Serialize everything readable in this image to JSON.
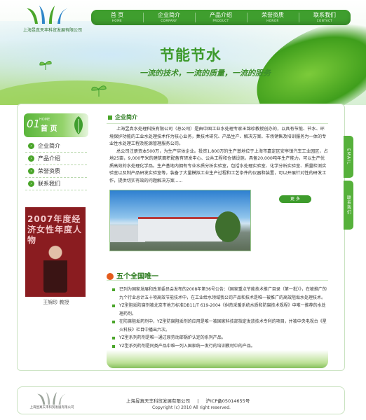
{
  "brand": {
    "company_name": "上海昱真天丰科贸发展有限公司"
  },
  "nav": [
    {
      "label": "首 页",
      "en": "HOME"
    },
    {
      "label": "企业简介",
      "en": "COMPANY"
    },
    {
      "label": "产品介绍",
      "en": "PRODUCT"
    },
    {
      "label": "荣誉资质",
      "en": "HONOR"
    },
    {
      "label": "联系我们",
      "en": "CONTACT"
    }
  ],
  "banner": {
    "slogan": "节能节水",
    "subslogan": "一流的技术，一流的质量，一流的服务"
  },
  "sidebar": {
    "head_num": "01",
    "head_en": "HOME",
    "head_title": "首 页",
    "items": [
      {
        "label": "企业简介"
      },
      {
        "label": "产品介绍"
      },
      {
        "label": "荣誉资质"
      },
      {
        "label": "联系我们"
      }
    ],
    "photo_text": "2007年度经济女性年度人物",
    "photo_caption": "王锦珍 教授"
  },
  "right_tabs": {
    "email": "EMAIL",
    "contact": "联系我们"
  },
  "intro_section": {
    "title": "企业简介",
    "paragraphs": [
      "上海昱真水处理科技有限公司（总公司）是由中国工业水处理专家王锦珍教授创办的，以具有节能、节水、环境保护功能的工业水处理技术作为核心业务，集技术研究、产品生产、解决方案、市场销售及培训服务为一体的专业性水处理工程及能源管理服务公司。",
      "总公司注册资本500万，为生产实体企业。投资1,800万的生产基地位于上海市嘉定区安亭镇汽车工业园区，占地25亩，9,000平米的建筑面积配备有研发中心、公共工程和仓储设施，具备20,000吨年生产能力，可以生产优质高效的水处理化学品。生产基地内拥有专业水质分析实验室，包括水处理实验室、化学分析实验室、质量检测实验室以及制产品研发实验室等，装备了大量模拟工业生产过程和工艺条件的仪器和装置，可以开展针对性的研发工作，提供切实有效的问题解决方案......"
    ],
    "more": "更 多"
  },
  "unique_section": {
    "title": "五个全国唯一",
    "bullets": [
      "已列为国家发展和改革委员会发布的2008年第36号公告：《国家重点节能技术推广目录（第一批）》，在被推广的九个行业总计五十项高效节能技术中，在工业给水领域我公司产品和技术是唯一被推广的高效阻垢水处理技术。",
      "YZ型阻垢防腐剂被北京市地方标准DB11/T 619-2004《供热采暖系统水质和防腐技术规程》中唯一推荐的水处理药剂。",
      "在防腐阻垢药剂中，YZ型防腐阻垢剂的应用是唯一被国家科技部指定发放技术专利的项目，并被中央电视台《星火科技》栏目中播出六次。",
      "YZ型系列药剂是唯一通过原劳动部锅炉认定的系列产品。",
      "YZ型系列药剂是同类产品中唯一列入国家统一发行的培训教材中的产品。"
    ]
  },
  "footer": {
    "company": "上海昱真天丰科贸发展有限公司",
    "icp": "沪ICP备05014655号",
    "copyright": "Copyright (c) 2010 All right reserved."
  },
  "colors": {
    "brand_green": "#3f9e2e",
    "accent_orange": "#e45b1c"
  }
}
